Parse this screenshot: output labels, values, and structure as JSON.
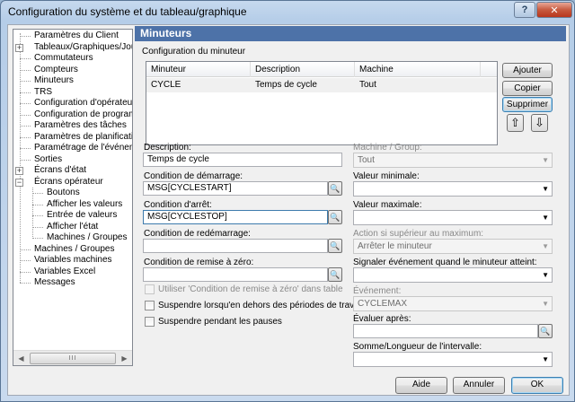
{
  "window": {
    "title": "Configuration du système et du tableau/graphique",
    "help_label": "?",
    "close_label": "✕"
  },
  "tree": {
    "items": [
      {
        "label": "Paramètres du Client",
        "level": 0,
        "expander": ""
      },
      {
        "label": "Tableaux/Graphiques/Journa",
        "level": 0,
        "expander": "+"
      },
      {
        "label": "Commutateurs",
        "level": 0,
        "expander": ""
      },
      {
        "label": "Compteurs",
        "level": 0,
        "expander": ""
      },
      {
        "label": "Minuteurs",
        "level": 0,
        "expander": ""
      },
      {
        "label": "TRS",
        "level": 0,
        "expander": ""
      },
      {
        "label": "Configuration d'opérateur",
        "level": 0,
        "expander": ""
      },
      {
        "label": "Configuration de programme",
        "level": 0,
        "expander": ""
      },
      {
        "label": "Paramètres des tâches",
        "level": 0,
        "expander": ""
      },
      {
        "label": "Paramètres de planification",
        "level": 0,
        "expander": ""
      },
      {
        "label": "Paramétrage de l'événement",
        "level": 0,
        "expander": ""
      },
      {
        "label": "Sorties",
        "level": 0,
        "expander": ""
      },
      {
        "label": "Écrans d'état",
        "level": 0,
        "expander": "+"
      },
      {
        "label": "Écrans opérateur",
        "level": 0,
        "expander": "−"
      },
      {
        "label": "Boutons",
        "level": 1,
        "expander": ""
      },
      {
        "label": "Afficher les valeurs",
        "level": 1,
        "expander": ""
      },
      {
        "label": "Entrée de valeurs",
        "level": 1,
        "expander": ""
      },
      {
        "label": "Afficher l'état",
        "level": 1,
        "expander": ""
      },
      {
        "label": "Machines / Groupes",
        "level": 1,
        "expander": ""
      },
      {
        "label": "Machines / Groupes",
        "level": 0,
        "expander": ""
      },
      {
        "label": "Variables machines",
        "level": 0,
        "expander": ""
      },
      {
        "label": "Variables Excel",
        "level": 0,
        "expander": ""
      },
      {
        "label": "Messages",
        "level": 0,
        "expander": ""
      }
    ],
    "scroll_left": "◀",
    "scroll_right": "▶",
    "scroll_grip": "III"
  },
  "panel": {
    "title": "Minuteurs",
    "group_label": "Configuration du minuteur"
  },
  "grid": {
    "columns": [
      "Minuteur",
      "Description",
      "Machine"
    ],
    "rows": [
      {
        "minuteur": "CYCLE",
        "description": "Temps de cycle",
        "machine": "Tout"
      }
    ]
  },
  "buttons": {
    "ajouter": "Ajouter",
    "copier": "Copier",
    "supprimer": "Supprimer",
    "move_up": "⇧",
    "move_down": "⇩",
    "aide": "Aide",
    "annuler": "Annuler",
    "ok": "OK"
  },
  "form_left": {
    "description_label": "Description:",
    "description_value": "Temps de cycle",
    "start_label": "Condition de démarrage:",
    "start_value": "MSG[CYCLESTART]",
    "stop_label": "Condition d'arrêt:",
    "stop_value": "MSG[CYCLESTOP]",
    "restart_label": "Condition de redémarrage:",
    "restart_value": "",
    "reset_label": "Condition de remise à zéro:",
    "reset_value": "",
    "use_reset_label": "Utiliser 'Condition de remise à zéro' dans tableaux/graphic",
    "suspend_outside_label": "Suspendre lorsqu'en dehors des périodes de travail",
    "suspend_pauses_label": "Suspendre pendant les pauses"
  },
  "form_right": {
    "machine_label": "Machine / Group:",
    "machine_value": "Tout",
    "min_label": "Valeur minimale:",
    "min_value": "",
    "max_label": "Valeur maximale:",
    "max_value": "",
    "action_label": "Action si supérieur au maximum:",
    "action_value": "Arrêter le minuteur",
    "signal_label": "Signaler événement quand le minuteur atteint:",
    "signal_value": "",
    "event_label": "Événement:",
    "event_value": "CYCLEMAX",
    "evaluate_label": "Évaluer après:",
    "evaluate_value": "",
    "sum_label": "Somme/Longueur de l'intervalle:",
    "sum_value": ""
  },
  "icons": {
    "lookup": "🔍",
    "dropdown": "▼"
  }
}
